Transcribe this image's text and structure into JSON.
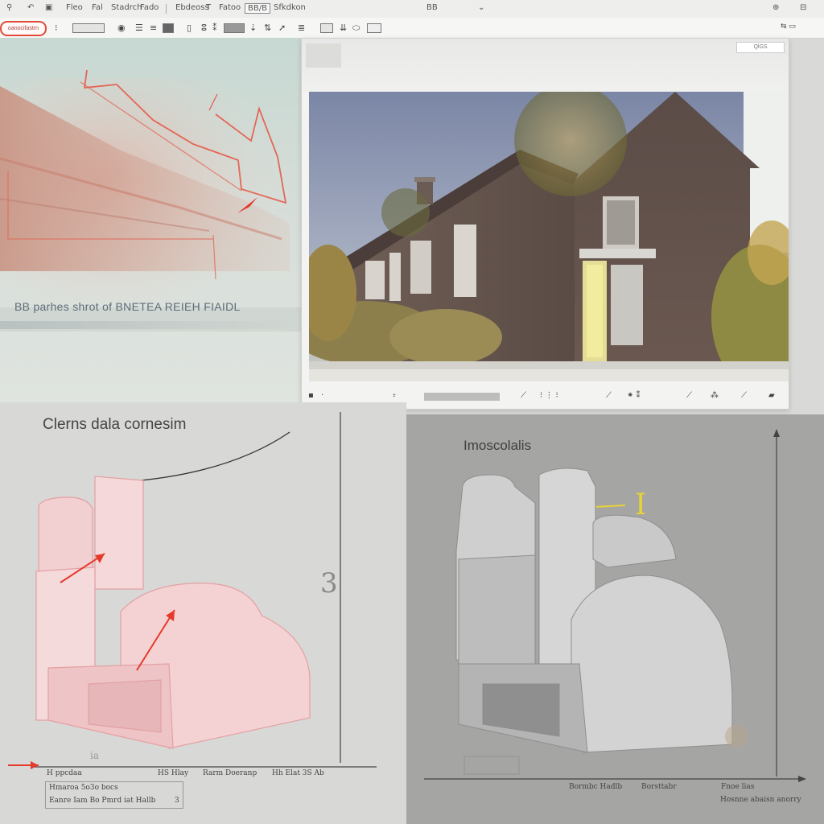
{
  "menu": {
    "items": [
      "Fleo",
      "Fal",
      "Stadrch",
      "Fado",
      "Ebdeoss",
      "Fatoo",
      "BB/B",
      "Sfkdkon"
    ],
    "center_mark": "BB"
  },
  "ribbon": {
    "highlight_text": "oanocifastrn"
  },
  "viewer": {
    "search_placeholder": "QlGS"
  },
  "top_left": {
    "caption": "BB  parhes shrot  of BNETEA REIEH FIAIDL"
  },
  "bottom_left": {
    "title": "Clerns dala cornesim",
    "side_number": "3",
    "arrow_label": "ia",
    "axis_labels": [
      "H ppcdaa",
      "HS Hlay",
      "Rarm Doeranp",
      "Hh Elat 3S Ab"
    ],
    "legend_rows": [
      "Hmaroa 5o3o bocs",
      "Eanre Iam Bo Pmrd iat Hallb",
      "3"
    ]
  },
  "bottom_right": {
    "title": "Imoscolalis",
    "axis_labels": [
      "Bormbc Hadlb",
      "Borsttabr",
      "Fnoe lias"
    ],
    "footnote": "Hosnne abaisn anorry"
  }
}
